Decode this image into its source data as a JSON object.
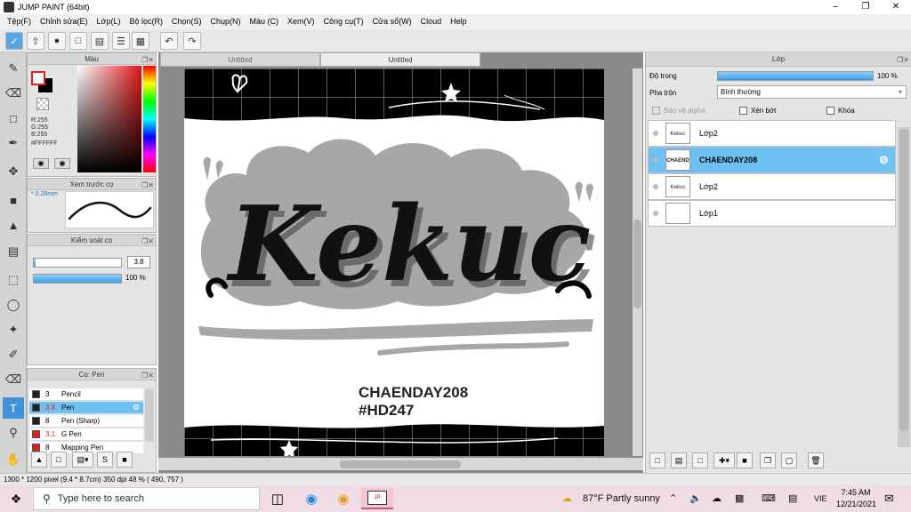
{
  "window": {
    "title": "JUMP PAINT (64bit)"
  },
  "menu": [
    "Tệp(F)",
    "Chỉnh sửa(E)",
    "Lớp(L)",
    "Bộ lọc(R)",
    "Chọn(S)",
    "Chụp(N)",
    "Màu (C)",
    "Xem(V)",
    "Công cụ(T)",
    "Cửa sổ(W)",
    "Cloud",
    "Help"
  ],
  "color_panel": {
    "title": "Màu",
    "r": "R:255",
    "g": "G:255",
    "b": "B:255",
    "hex": "#FFFFFF",
    "fg_color": "#FFFFFF",
    "bg_color": "#000000"
  },
  "brush_preview": {
    "title": "Xem trước cọ",
    "size": "* 0.28mm"
  },
  "brush_control": {
    "title": "Kiểm soát cọ",
    "size_value": "3.8",
    "opacity_label": "100 %",
    "opacity": 1.0,
    "size_level": 0.02
  },
  "brush_list": {
    "title": "Cọ: Pen",
    "items": [
      {
        "size": "3",
        "name": "Pencil",
        "color": "#222222",
        "size_red": false,
        "selected": false
      },
      {
        "size": "3.8",
        "name": "Pen",
        "color": "#222222",
        "size_red": true,
        "selected": true
      },
      {
        "size": "8",
        "name": "Pen (Sharp)",
        "color": "#222222",
        "size_red": false,
        "selected": false
      },
      {
        "size": "3.1",
        "name": "G Pen",
        "color": "#e02020",
        "size_red": true,
        "selected": false
      },
      {
        "size": "8",
        "name": "Mapping Pen",
        "color": "#e02020",
        "size_red": false,
        "selected": false
      }
    ]
  },
  "tabs": [
    "Untitled",
    "Untitled"
  ],
  "artwork": {
    "main_text": "Kekuc",
    "caption_line1": "CHAENDAY208",
    "caption_line2": "#HD247"
  },
  "status": {
    "text": "1300 * 1200 pixel   (9.4 * 8.7cm)   350 dpi   48 %   ( 490, 757 )"
  },
  "layers_panel": {
    "title": "Lớp",
    "opacity_label": "Độ trong",
    "opacity_value": "100 %",
    "opacity": 1.0,
    "blend_label": "Pha trộn",
    "blend_value": "Bình thường",
    "protect_alpha": "Bảo vệ alpha",
    "clip": "Xén bớt",
    "lock": "Khóa",
    "layers": [
      {
        "name": "Lớp2",
        "thumb": "Kekuc",
        "selected": false
      },
      {
        "name": "CHAENDAY208",
        "thumb": "CHAENDAY",
        "selected": true
      },
      {
        "name": "Lớp2",
        "thumb": "Kekuc",
        "selected": false
      },
      {
        "name": "Lớp1",
        "thumb": "",
        "selected": false
      }
    ]
  },
  "taskbar": {
    "search_placeholder": "Type here to search",
    "weather": "87°F  Partly sunny",
    "lang": "VIE",
    "time": "7:45 AM",
    "date": "12/21/2021"
  }
}
